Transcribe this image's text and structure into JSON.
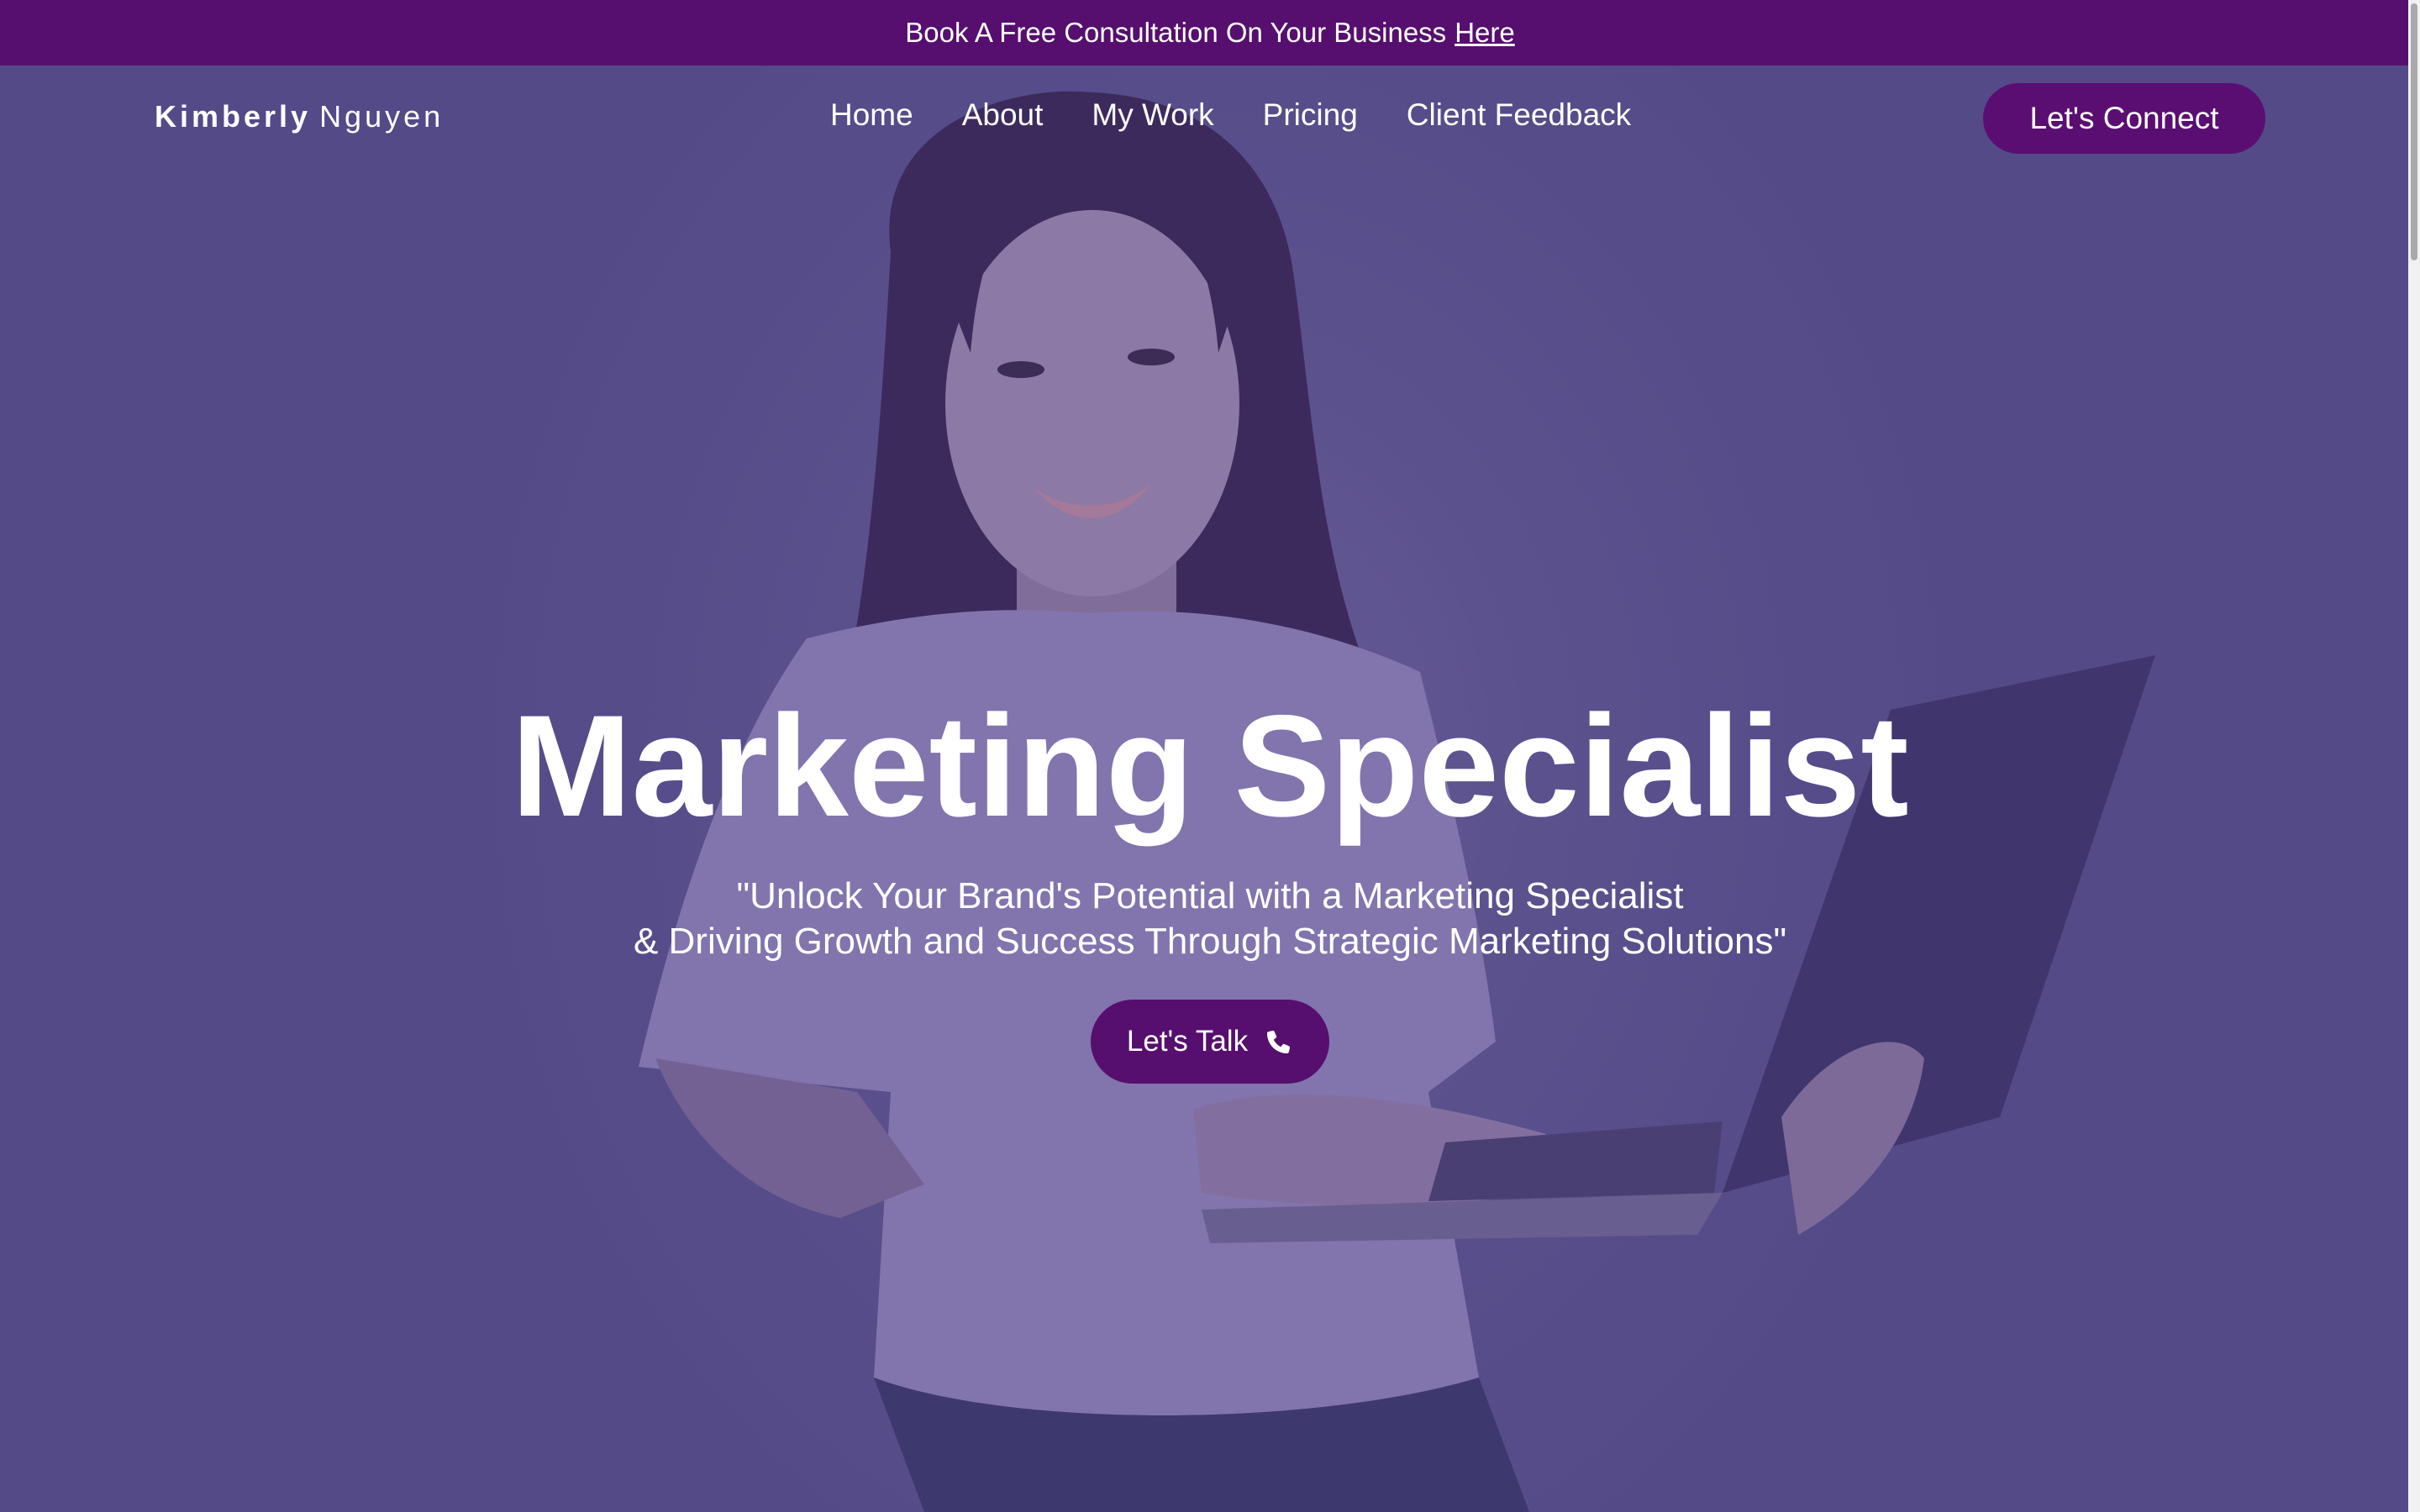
{
  "announcement": {
    "text": "Book A Free Consultation On Your Business",
    "link_label": "Here"
  },
  "nav": {
    "brand_first": "Kimberly",
    "brand_last": "Nguyen",
    "items": [
      {
        "label": "Home"
      },
      {
        "label": "About"
      },
      {
        "label": "My Work"
      },
      {
        "label": "Pricing"
      },
      {
        "label": "Client Feedback"
      }
    ],
    "cta_label": "Let's Connect"
  },
  "hero": {
    "title": "Marketing Specialist",
    "subtitle_line1": "\"Unlock Your Brand's Potential with a Marketing Specialist",
    "subtitle_line2": "& Driving Growth and Success Through Strategic Marketing Solutions\"",
    "cta_label": "Let's Talk",
    "cta_icon": "phone-icon"
  },
  "colors": {
    "accent": "#560f6e",
    "hero_tint": "#5a5488",
    "text": "#ffffff"
  }
}
